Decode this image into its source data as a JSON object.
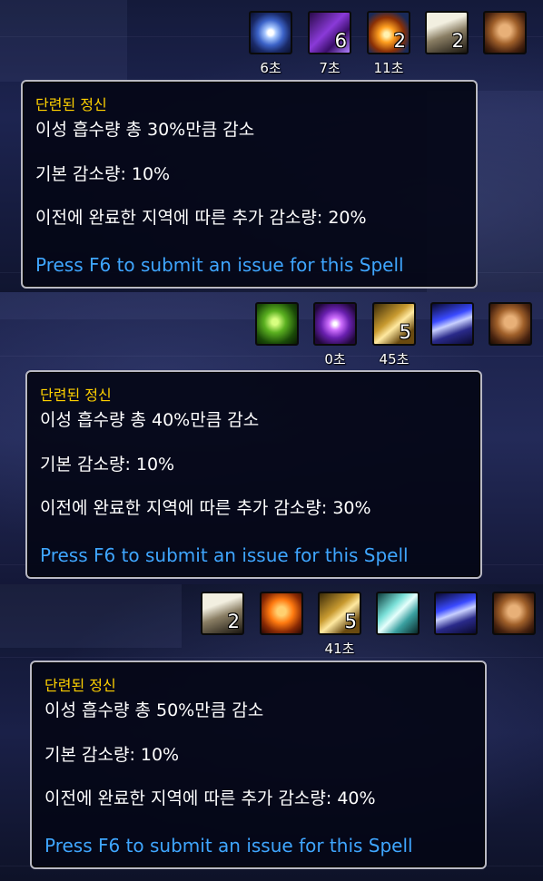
{
  "colors": {
    "title": "#ffd100",
    "body": "#ffffff",
    "link": "#3fa6ff",
    "border": "#b9b9c4"
  },
  "panels": [
    {
      "auras": [
        {
          "icon": "arcane-swirl-icon",
          "stack": "",
          "duration": "6초"
        },
        {
          "icon": "purple-rune-icon",
          "stack": "6",
          "duration": "7초"
        },
        {
          "icon": "fire-orb-icon",
          "stack": "2",
          "duration": "11초"
        },
        {
          "icon": "horse-rider-icon",
          "stack": "2",
          "duration": ""
        },
        {
          "icon": "bearded-face-icon",
          "stack": "",
          "duration": ""
        }
      ],
      "tooltip": {
        "title": "단련된 정신",
        "line1": "이성 흡수량 총 30%만큼 감소",
        "line2": "기본 감소량: 10%",
        "line3": "이전에 완료한 지역에 따른 추가 감소량: 20%",
        "link": "Press F6 to submit an issue for this Spell"
      }
    },
    {
      "auras": [
        {
          "icon": "green-burst-icon",
          "stack": "",
          "duration": ""
        },
        {
          "icon": "violet-star-icon",
          "stack": "",
          "duration": "0초"
        },
        {
          "icon": "golden-blades-icon",
          "stack": "5",
          "duration": "45초"
        },
        {
          "icon": "blue-crystals-icon",
          "stack": "",
          "duration": ""
        },
        {
          "icon": "bearded-face-icon",
          "stack": "",
          "duration": ""
        }
      ],
      "tooltip": {
        "title": "단련된 정신",
        "line1": "이성 흡수량 총 40%만큼 감소",
        "line2": "기본 감소량: 10%",
        "line3": "이전에 완료한 지역에 따른 추가 감소량: 30%",
        "link": "Press F6 to submit an issue for this Spell"
      }
    },
    {
      "auras": [
        {
          "icon": "horse-rider-icon",
          "stack": "2",
          "duration": ""
        },
        {
          "icon": "flame-face-icon",
          "stack": "",
          "duration": ""
        },
        {
          "icon": "golden-blades-icon",
          "stack": "5",
          "duration": "41초"
        },
        {
          "icon": "frost-swirl-icon",
          "stack": "",
          "duration": ""
        },
        {
          "icon": "blue-crystals-icon",
          "stack": "",
          "duration": ""
        },
        {
          "icon": "bearded-face-icon",
          "stack": "",
          "duration": ""
        }
      ],
      "tooltip": {
        "title": "단련된 정신",
        "line1": "이성 흡수량 총 50%만큼 감소",
        "line2": "기본 감소량: 10%",
        "line3": "이전에 완료한 지역에 따른 추가 감소량: 40%",
        "link": "Press F6 to submit an issue for this Spell"
      }
    }
  ]
}
